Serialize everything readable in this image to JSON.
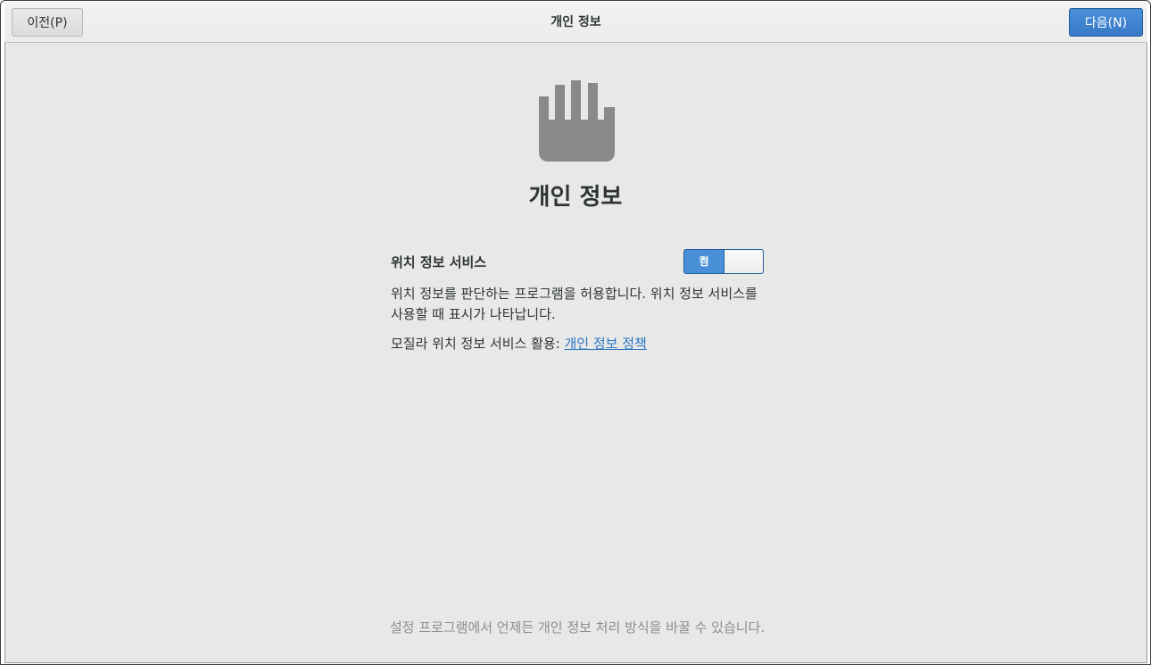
{
  "header": {
    "title": "개인 정보",
    "prev_label": "이전(P)",
    "next_label": "다음(N)"
  },
  "main": {
    "icon": "hand-stop-icon",
    "title": "개인 정보",
    "location_services": {
      "label": "위치 정보 서비스",
      "toggle_state_label": "켬",
      "enabled": true,
      "description": "위치 정보를 판단하는 프로그램을 허용합니다. 위치 정보 서비스를 사용할 때 표시가 나타납니다.",
      "mozilla_prefix": "모질라 위치 정보 서비스 활용: ",
      "policy_link": "개인 정보 정책"
    },
    "footer_note": "설정 프로그램에서 언제든 개인 정보 처리 방식을 바꿀 수 있습니다."
  },
  "colors": {
    "accent": "#4a90d9",
    "window_bg": "#e8e8e7",
    "icon_gray": "#888a8a",
    "link": "#2a76c6"
  }
}
